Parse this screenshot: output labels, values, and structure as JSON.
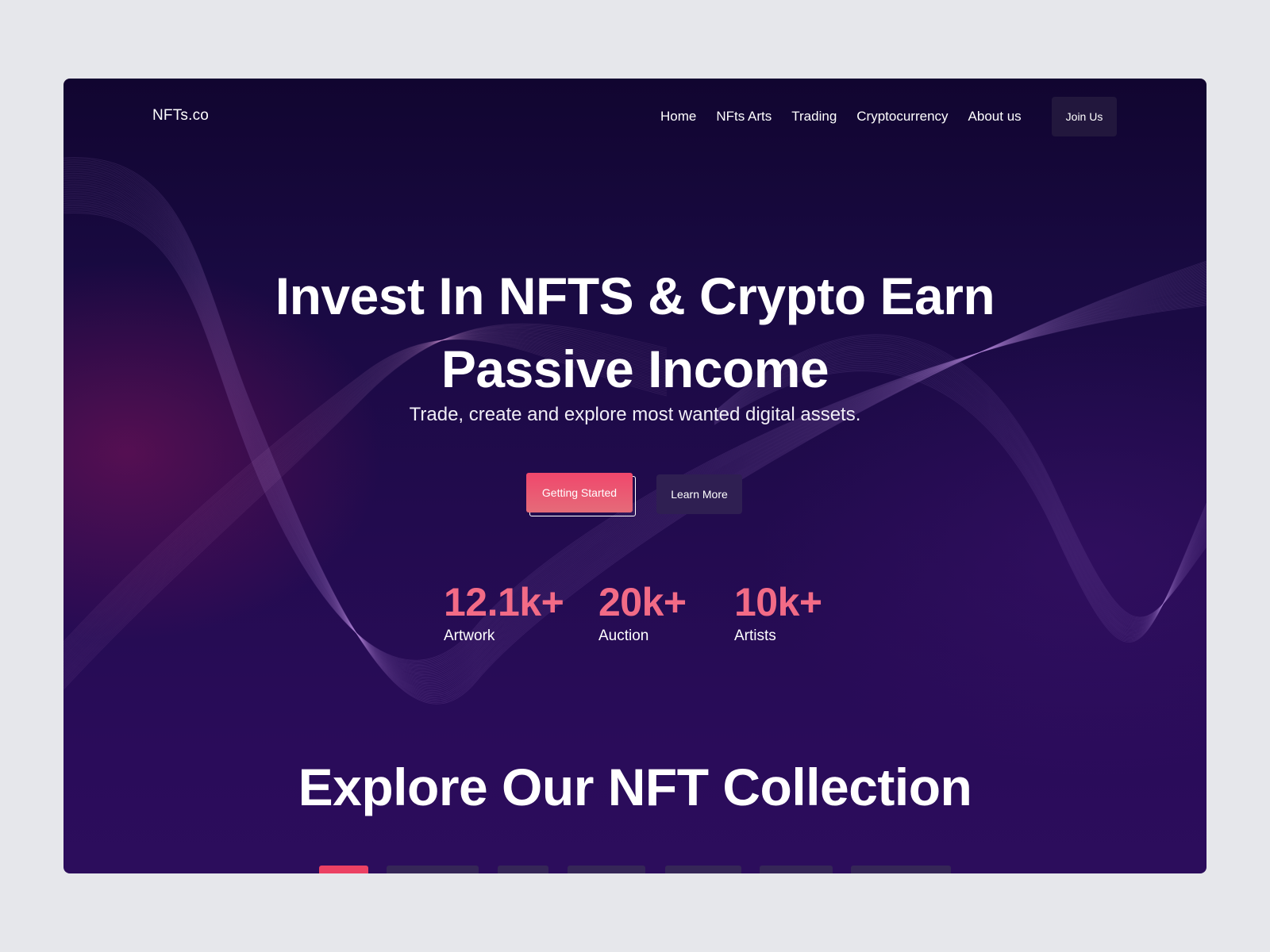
{
  "brand": {
    "logo": "NFTs.co"
  },
  "nav": {
    "items": [
      "Home",
      "NFts Arts",
      "Trading",
      "Cryptocurrency",
      "About us"
    ],
    "join_label": "Join Us"
  },
  "hero": {
    "title_line1": "Invest In NFTS & Crypto Earn",
    "title_line2": "Passive Income",
    "subtitle": "Trade, create and explore most wanted digital assets.",
    "primary_cta": "Getting Started",
    "secondary_cta": "Learn More"
  },
  "stats": [
    {
      "value": "12.1k+",
      "label": "Artwork"
    },
    {
      "value": "20k+",
      "label": "Auction"
    },
    {
      "value": "10k+",
      "label": "Artists"
    }
  ],
  "collection": {
    "title": "Explore Our NFT Collection",
    "filter_count": 7,
    "active_filter_index": 0
  },
  "colors": {
    "page_bg": "#e6e7eb",
    "hero_bg_top": "#110530",
    "hero_bg_bottom": "#2c0d5c",
    "accent": "#f0476c",
    "stat_value": "#f26b86",
    "secondary_button": "#2f1f52"
  }
}
